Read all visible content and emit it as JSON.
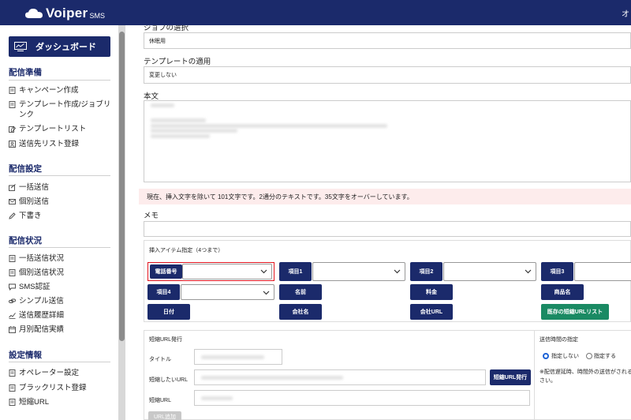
{
  "header": {
    "brand": "Voiper",
    "brand_sub": "SMS",
    "top_right": "オ",
    "accent": "#1b2a6b"
  },
  "sidebar": {
    "dashboard": "ダッシュボード",
    "sections": [
      {
        "title": "配信準備",
        "items": [
          "キャンペーン作成",
          "テンプレート作成/ジョブリンク",
          "テンプレートリスト",
          "送信先リスト登録"
        ]
      },
      {
        "title": "配信設定",
        "items": [
          "一括送信",
          "個別送信",
          "下書き"
        ]
      },
      {
        "title": "配信状況",
        "items": [
          "一括送信状況",
          "個別送信状況",
          "SMS認証",
          "シンプル送信",
          "送信履歴詳細",
          "月別配信実績"
        ]
      },
      {
        "title": "設定情報",
        "items": [
          "オペレーター設定",
          "ブラックリスト登録",
          "短縮URL"
        ]
      }
    ]
  },
  "main": {
    "job_label": "ジョブの選択",
    "job_value": "休眠用",
    "template_label": "テンプレートの適用",
    "template_value": "変更しない",
    "body_label": "本文",
    "notice": "現在、挿入文字を除いて 101文字です。2通分のテキストです。35文字をオーバーしています。",
    "memo_label": "メモ",
    "insert": {
      "title": "挿入アイテム指定（4つまで）",
      "selects": [
        "電話番号",
        "項目1",
        "項目2",
        "項目3",
        "項目4"
      ],
      "buttons": [
        "名前",
        "料金",
        "商品名",
        "日付",
        "会社名",
        "会社URL"
      ],
      "existing_list": "既存の短縮URLリスト"
    },
    "short_url": {
      "title": "短縮URL発行",
      "title_label": "タイトル",
      "target_label": "短縮したいURL",
      "issue_button": "短縮URL発行",
      "url_label": "短縮URL",
      "add_button": "URL追加"
    },
    "send_time": {
      "title": "送信時間の指定",
      "options": [
        "指定しない",
        "指定する"
      ],
      "selected": "指定しない",
      "note": "※配信遅延時、時間外の送信がされる",
      "note2": "さい。"
    }
  },
  "colors": {
    "navy": "#1b2a6b",
    "green": "#1a8a63",
    "highlight": "#e0141e",
    "notice_bg": "#fdecec"
  }
}
